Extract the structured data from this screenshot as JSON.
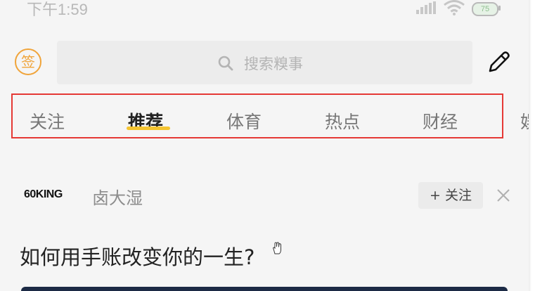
{
  "status_bar": {
    "time": "下午1:59",
    "battery": "75"
  },
  "header": {
    "sign_label": "签",
    "search_placeholder": "搜索糗事"
  },
  "tabs": [
    {
      "label": "关注",
      "active": false
    },
    {
      "label": "推荐",
      "active": true
    },
    {
      "label": "体育",
      "active": false
    },
    {
      "label": "热点",
      "active": false
    },
    {
      "label": "财经",
      "active": false
    },
    {
      "label": "娱",
      "active": false
    }
  ],
  "article": {
    "source_logo": "60KING",
    "author": "卤大湿",
    "follow_label": "+ 关注",
    "title": "如何用手账改变你的一生?"
  },
  "colors": {
    "accent": "#f4c430",
    "sign_badge": "#f0a43a",
    "highlight": "#e53935"
  },
  "icons": [
    "search-icon",
    "edit-icon",
    "close-icon",
    "wifi-icon",
    "signal-icon"
  ]
}
